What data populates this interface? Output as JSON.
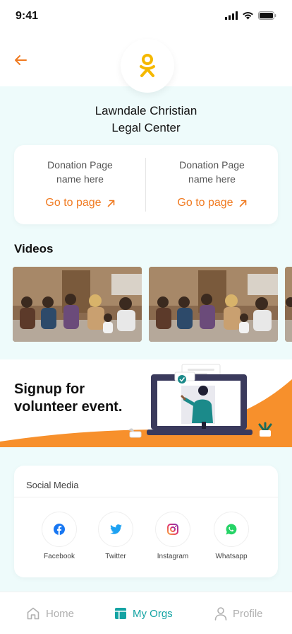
{
  "status_bar": {
    "time": "9:41"
  },
  "header": {
    "back_icon": "arrow-left-icon"
  },
  "org": {
    "logo_icon": "odnoklassniki-icon",
    "name_line1": "Lawndale Christian",
    "name_line2": "Legal Center"
  },
  "donations": [
    {
      "title_line1": "Donation Page",
      "title_line2": "name here",
      "link_label": "Go to page"
    },
    {
      "title_line1": "Donation Page",
      "title_line2": "name here",
      "link_label": "Go to page"
    }
  ],
  "videos": {
    "title": "Videos"
  },
  "banner": {
    "line1": "Signup for",
    "line2": "volunteer event."
  },
  "social": {
    "title": "Social Media",
    "items": [
      {
        "label": "Facebook",
        "icon": "facebook-icon"
      },
      {
        "label": "Twitter",
        "icon": "twitter-icon"
      },
      {
        "label": "Instagram",
        "icon": "instagram-icon"
      },
      {
        "label": "Whatsapp",
        "icon": "whatsapp-icon"
      }
    ]
  },
  "nav": {
    "home": "Home",
    "my_orgs": "My Orgs",
    "profile": "Profile",
    "active": "my_orgs"
  },
  "colors": {
    "accent_orange": "#f07b22",
    "accent_teal": "#14a3a3",
    "mint_background": "#eefbfb"
  }
}
